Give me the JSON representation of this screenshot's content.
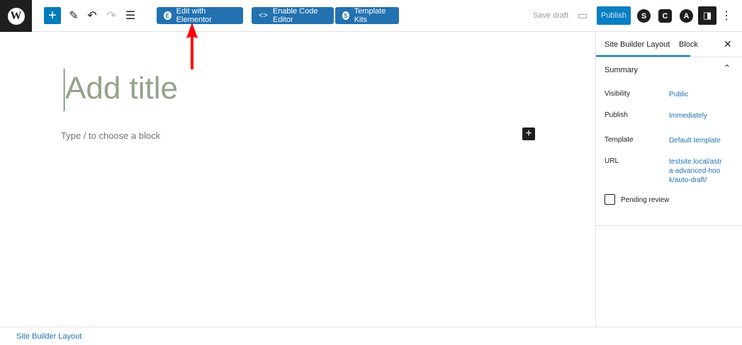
{
  "toolbar": {
    "logo": "W",
    "add": "+",
    "edit_elementor": "Edit with Elementor",
    "code_editor": "Enable Code Editor",
    "template_kits": "Template Kits",
    "save_draft": "Save draft",
    "publish": "Publish"
  },
  "editor": {
    "title_placeholder": "Add title",
    "block_placeholder": "Type / to choose a block"
  },
  "sidebar": {
    "tabs": [
      "Site Builder Layout",
      "Block"
    ],
    "section": "Summary",
    "rows": [
      {
        "label": "Visibility",
        "value": "Public"
      },
      {
        "label": "Publish",
        "value": "Immediately"
      },
      {
        "label": "Template",
        "value": "Default template"
      },
      {
        "label": "URL",
        "value": "testsite.local/astra-advanced-hook/auto-draft/"
      }
    ],
    "pending": "Pending review"
  },
  "footer": {
    "breadcrumb": "Site Builder Layout"
  }
}
